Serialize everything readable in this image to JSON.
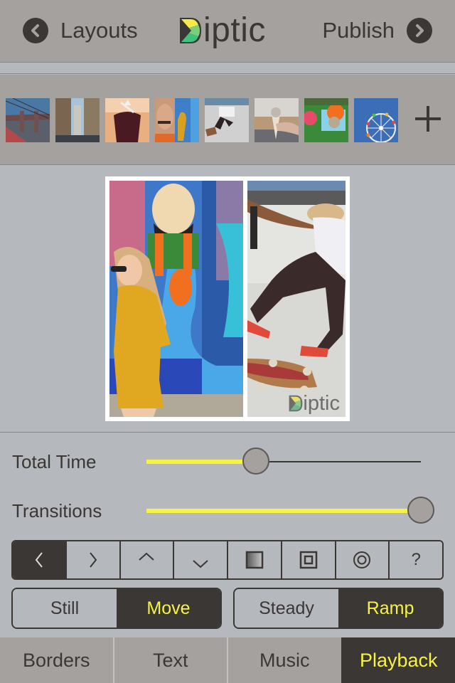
{
  "navbar": {
    "back_label": "Layouts",
    "back_icon": "chevron-left-circle-icon",
    "logo_text": "iptic",
    "logo_full": "Diptic",
    "forward_label": "Publish",
    "forward_icon": "chevron-right-circle-icon"
  },
  "photo_strip": {
    "thumbnails": [
      {
        "subject": "bridge-with-city-skyline"
      },
      {
        "subject": "city-street-buildings"
      },
      {
        "subject": "iced-drink-in-glass"
      },
      {
        "subject": "woman-by-graffiti-mural"
      },
      {
        "subject": "skateboarder-jumping"
      },
      {
        "subject": "hand-holding-ice-cream-cone"
      },
      {
        "subject": "aerial-amusement-park"
      },
      {
        "subject": "ferris-wheel-blue-sky"
      }
    ],
    "add_icon": "plus-icon"
  },
  "preview": {
    "panes": [
      {
        "subject": "woman-in-yellow-dress-by-graffiti"
      },
      {
        "subject": "skateboarder-mid-air-trick"
      }
    ],
    "watermark": "iptic"
  },
  "sliders": {
    "total_time": {
      "label": "Total Time",
      "value": 0.4
    },
    "transitions": {
      "label": "Transitions",
      "value": 1.0
    }
  },
  "direction_segment": {
    "items": [
      {
        "name": "left",
        "icon": "chevron-left-icon",
        "glyph": "‹",
        "active": true
      },
      {
        "name": "right",
        "icon": "chevron-right-icon",
        "glyph": "›",
        "active": false
      },
      {
        "name": "up",
        "icon": "chevron-up-icon",
        "glyph": "^",
        "active": false
      },
      {
        "name": "down",
        "icon": "chevron-down-icon",
        "glyph": "v",
        "active": false
      },
      {
        "name": "gradient",
        "icon": "gradient-square-icon",
        "glyph": "",
        "active": false
      },
      {
        "name": "inset",
        "icon": "inset-square-icon",
        "glyph": "",
        "active": false
      },
      {
        "name": "zoom",
        "icon": "concentric-circle-icon",
        "glyph": "",
        "active": false
      },
      {
        "name": "random",
        "icon": "question-mark-icon",
        "glyph": "?",
        "active": false
      }
    ]
  },
  "motion_segment": {
    "options": [
      "Still",
      "Move"
    ],
    "selected": "Move"
  },
  "speed_segment": {
    "options": [
      "Steady",
      "Ramp"
    ],
    "selected": "Ramp"
  },
  "tabbar": {
    "tabs": [
      "Borders",
      "Text",
      "Music",
      "Playback"
    ],
    "selected": "Playback"
  },
  "colors": {
    "accent_yellow": "#f8f342",
    "dark": "#3a3734",
    "bar_gray": "#a5a19e",
    "bg_gray": "#b5b9bd"
  }
}
